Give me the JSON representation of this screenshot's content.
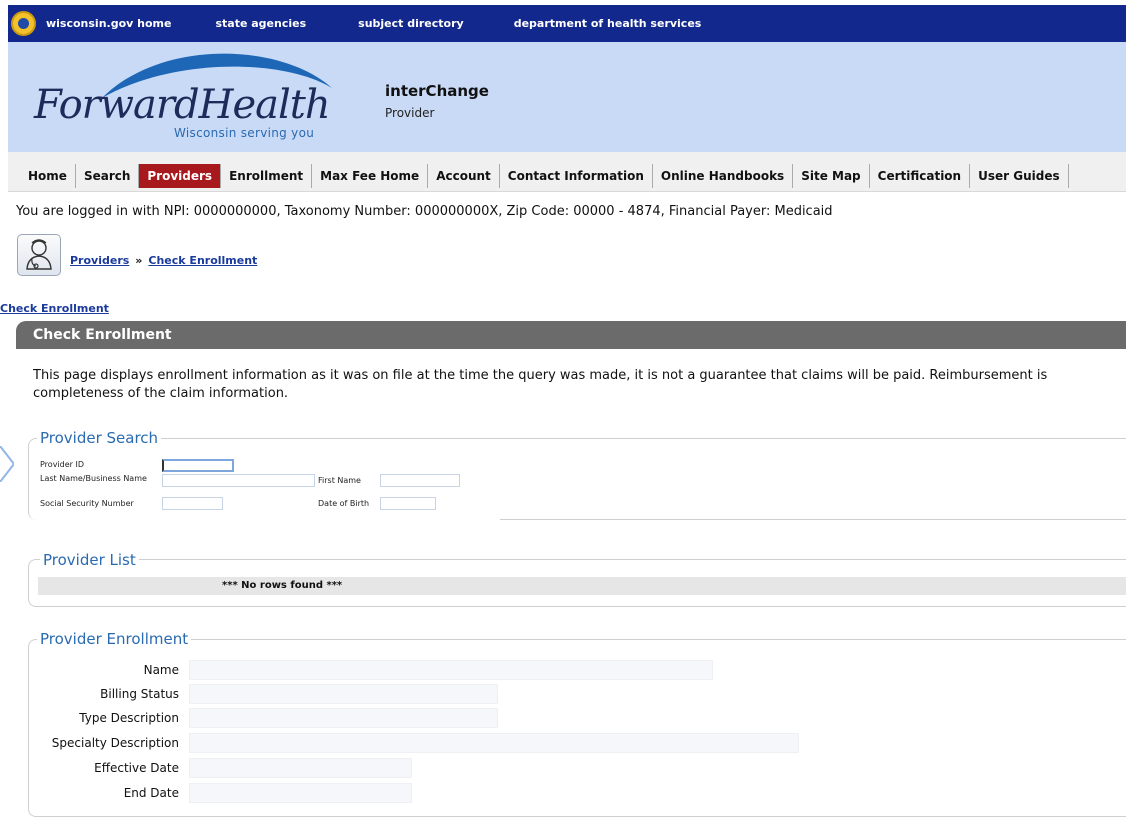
{
  "topbar": {
    "links": [
      "wisconsin.gov home",
      "state agencies",
      "subject directory",
      "department of health services"
    ]
  },
  "header": {
    "logo_text": "ForwardHealth",
    "logo_tagline": "Wisconsin serving you",
    "app_title": "interChange",
    "app_subtitle": "Provider"
  },
  "nav": {
    "items": [
      "Home",
      "Search",
      "Providers",
      "Enrollment",
      "Max Fee Home",
      "Account",
      "Contact Information",
      "Online Handbooks",
      "Site Map",
      "Certification",
      "User Guides"
    ],
    "active": "Providers"
  },
  "session": {
    "logged_in_text": "You are logged in with NPI: 0000000000, Taxonomy Number: 000000000X, Zip Code: 00000 - 4874, Financial Payer: Medicaid"
  },
  "breadcrumb": {
    "items": [
      "Providers",
      "Check Enrollment"
    ],
    "separator": "»"
  },
  "page_link": "Check Enrollment",
  "section_title": "Check Enrollment",
  "intro_lines": [
    "This page displays enrollment information as it was on file at the time the query was made, it is not a guarantee that claims will be paid. Reimbursement is",
    "completeness of the claim information."
  ],
  "provider_search": {
    "legend": "Provider Search",
    "labels": {
      "provider_id": "Provider ID",
      "last_name": "Last Name/Business Name",
      "first_name": "First Name",
      "ssn": "Social Security Number",
      "dob": "Date of Birth"
    },
    "values": {
      "provider_id": "",
      "last_name": "",
      "first_name": "",
      "ssn": "",
      "dob": ""
    }
  },
  "provider_list": {
    "legend": "Provider List",
    "empty_message": "*** No rows found ***"
  },
  "provider_enrollment": {
    "legend": "Provider Enrollment",
    "labels": [
      "Name",
      "Billing Status",
      "Type Description",
      "Specialty Description",
      "Effective Date",
      "End Date"
    ],
    "values": [
      "",
      "",
      "",
      "",
      "",
      ""
    ]
  },
  "colors": {
    "topbar": "#12288d",
    "header_bg": "#c9daf6",
    "nav_active": "#a8191d",
    "section_bar": "#6b6b6b",
    "legend_text": "#2a6ab0",
    "link": "#1a3a9c"
  }
}
